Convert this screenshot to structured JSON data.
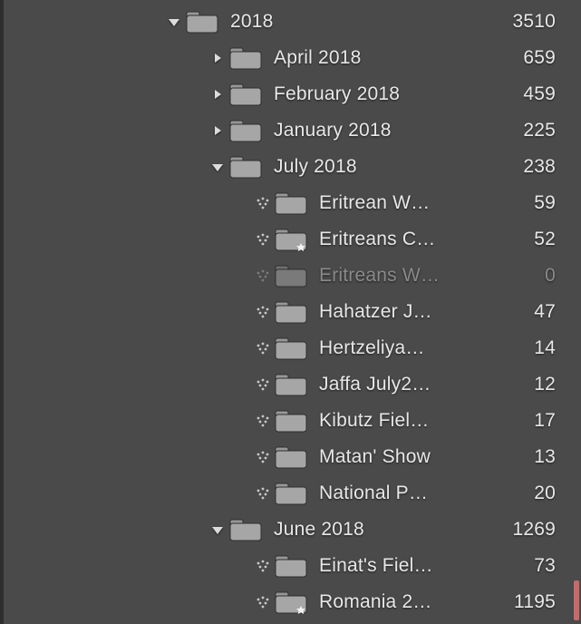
{
  "tree": [
    {
      "indent": 0,
      "arrow": "down",
      "dots": false,
      "star": false,
      "dim": false,
      "label": "2018",
      "count": "3510"
    },
    {
      "indent": 1,
      "arrow": "right",
      "dots": false,
      "star": false,
      "dim": false,
      "label": "April 2018",
      "count": "659"
    },
    {
      "indent": 1,
      "arrow": "right",
      "dots": false,
      "star": false,
      "dim": false,
      "label": "February 2018",
      "count": "459"
    },
    {
      "indent": 1,
      "arrow": "right",
      "dots": false,
      "star": false,
      "dim": false,
      "label": "January 2018",
      "count": "225"
    },
    {
      "indent": 1,
      "arrow": "down",
      "dots": false,
      "star": false,
      "dim": false,
      "label": "July 2018",
      "count": "238"
    },
    {
      "indent": 2,
      "arrow": "none",
      "dots": true,
      "star": false,
      "dim": false,
      "label": "Eritrean W…",
      "count": "59"
    },
    {
      "indent": 2,
      "arrow": "none",
      "dots": true,
      "star": true,
      "dim": false,
      "label": "Eritreans C…",
      "count": "52"
    },
    {
      "indent": 2,
      "arrow": "none",
      "dots": true,
      "star": false,
      "dim": true,
      "label": "Eritreans W…",
      "count": "0"
    },
    {
      "indent": 2,
      "arrow": "none",
      "dots": true,
      "star": false,
      "dim": false,
      "label": "Hahatzer J…",
      "count": "47"
    },
    {
      "indent": 2,
      "arrow": "none",
      "dots": true,
      "star": false,
      "dim": false,
      "label": "Hertzeliya…",
      "count": "14"
    },
    {
      "indent": 2,
      "arrow": "none",
      "dots": true,
      "star": false,
      "dim": false,
      "label": "Jaffa July2…",
      "count": "12"
    },
    {
      "indent": 2,
      "arrow": "none",
      "dots": true,
      "star": false,
      "dim": false,
      "label": "Kibutz Fiel…",
      "count": "17"
    },
    {
      "indent": 2,
      "arrow": "none",
      "dots": true,
      "star": false,
      "dim": false,
      "label": "Matan' Show",
      "count": "13"
    },
    {
      "indent": 2,
      "arrow": "none",
      "dots": true,
      "star": false,
      "dim": false,
      "label": "National P…",
      "count": "20"
    },
    {
      "indent": 1,
      "arrow": "down",
      "dots": false,
      "star": false,
      "dim": false,
      "label": "June 2018",
      "count": "1269"
    },
    {
      "indent": 2,
      "arrow": "none",
      "dots": true,
      "star": false,
      "dim": false,
      "label": "Einat's Fiel…",
      "count": "73"
    },
    {
      "indent": 2,
      "arrow": "none",
      "dots": true,
      "star": true,
      "dim": false,
      "label": "Romania 2…",
      "count": "1195"
    }
  ]
}
